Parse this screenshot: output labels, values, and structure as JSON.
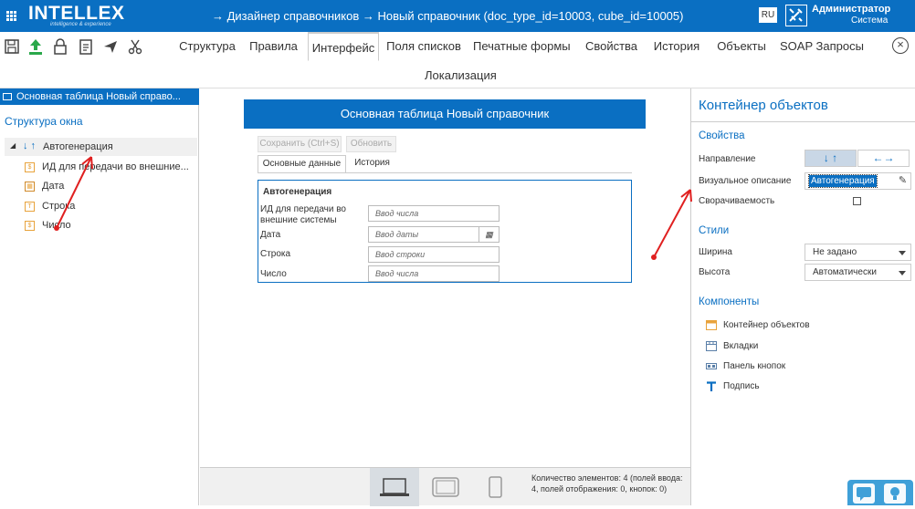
{
  "app": {
    "logo": "INTELLEX",
    "logo_sub": "intelligence & experience",
    "breadcrumb": "→  Дизайнер справочников  →  Новый справочник (doc_type_id=10003, cube_id=10005)",
    "lang": "RU",
    "user_name": "Администратор",
    "user_role": "Система",
    "accent": "#0a6fc2"
  },
  "toolbar": {
    "icons": [
      "save-icon",
      "upload-icon",
      "lock-icon",
      "document-icon",
      "send-icon",
      "scissors-icon"
    ]
  },
  "tabs": [
    {
      "label": "Структура",
      "active": false
    },
    {
      "label": "Правила",
      "active": false
    },
    {
      "label": "Интерфейс",
      "active": true
    },
    {
      "label": "Поля списков",
      "active": false
    },
    {
      "label": "Печатные формы",
      "active": false
    },
    {
      "label": "Свойства",
      "active": false
    },
    {
      "label": "История",
      "active": false
    },
    {
      "label": "Объекты",
      "active": false
    },
    {
      "label": "SOAP Запросы",
      "active": false
    }
  ],
  "tabs_row2": "Локализация",
  "left": {
    "title": "Основная таблица Новый справо...",
    "structure_label": "Структура окна",
    "root": "Автогенерация",
    "items": [
      "ИД для передачи во внешние...",
      "Дата",
      "Строка",
      "Число"
    ]
  },
  "form": {
    "title": "Основная таблица Новый справочник",
    "save_button": "Сохранить (Ctrl+S)",
    "refresh_button": "Обновить",
    "tabs": [
      "Основные данные",
      "История"
    ],
    "group_title": "Автогенерация",
    "fields": [
      {
        "label": "ИД для передачи во внешние системы",
        "placeholder": "Ввод числа"
      },
      {
        "label": "Дата",
        "placeholder": "Ввод даты"
      },
      {
        "label": "Строка",
        "placeholder": "Ввод строки"
      },
      {
        "label": "Число",
        "placeholder": "Ввод числа"
      }
    ]
  },
  "bottom": {
    "count_text": "Количество элементов: 4 (полей ввода: 4, полей отображения: 0, кнопок: 0)"
  },
  "right": {
    "title": "Контейнер объектов",
    "props_section": "Свойства",
    "direction_label": "Направление",
    "direction_vertical": "↓ ↑",
    "direction_horizontal": "←→",
    "visual_label": "Визуальное описание",
    "visual_value": "Автогенерация",
    "collapse_label": "Сворачиваемость",
    "styles_section": "Стили",
    "width_label": "Ширина",
    "width_value": "Не задано",
    "height_label": "Высота",
    "height_value": "Автоматически",
    "components_section": "Компоненты",
    "components": [
      "Контейнер объектов",
      "Вкладки",
      "Панель кнопок",
      "Подпись"
    ]
  }
}
